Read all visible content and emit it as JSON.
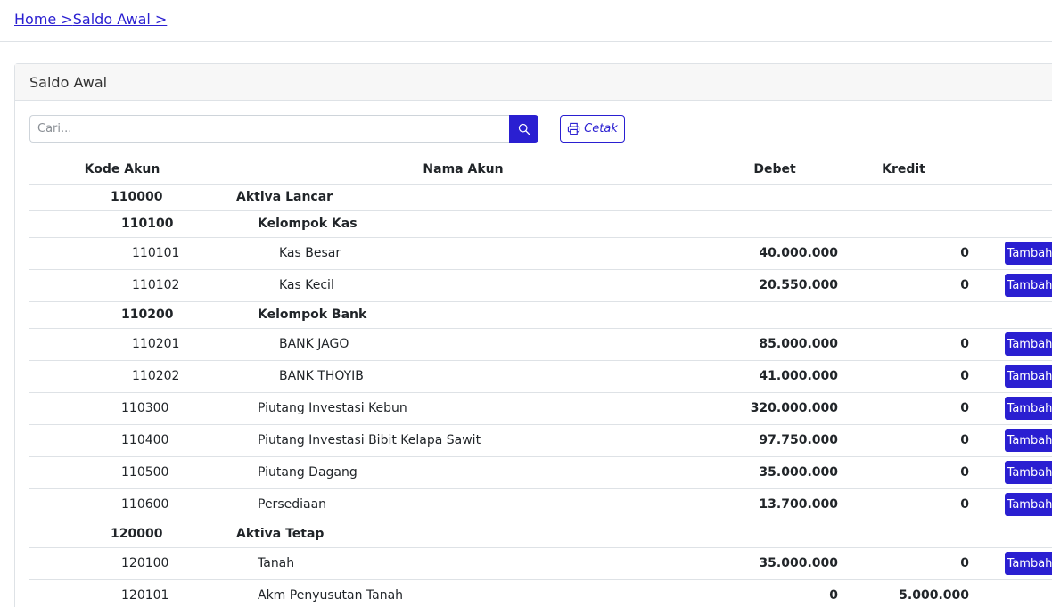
{
  "breadcrumb": {
    "home": "Home >",
    "current": "Saldo Awal >"
  },
  "card": {
    "title": "Saldo Awal"
  },
  "search": {
    "placeholder": "Cari..."
  },
  "print_label": "Cetak",
  "table": {
    "headers": {
      "kode": "Kode Akun",
      "nama": "Nama Akun",
      "debet": "Debet",
      "kredit": "Kredit"
    },
    "add_label": "Tambah",
    "rows": [
      {
        "type": "group",
        "level": 0,
        "kode": "110000",
        "nama": "Aktiva Lancar"
      },
      {
        "type": "group",
        "level": 1,
        "kode": "110100",
        "nama": "Kelompok Kas"
      },
      {
        "type": "item",
        "level": 2,
        "kode": "110101",
        "nama": "Kas Besar",
        "debet": "40.000.000",
        "kredit": "0",
        "button": true
      },
      {
        "type": "item",
        "level": 2,
        "kode": "110102",
        "nama": "Kas Kecil",
        "debet": "20.550.000",
        "kredit": "0",
        "button": true
      },
      {
        "type": "group",
        "level": 1,
        "kode": "110200",
        "nama": "Kelompok Bank"
      },
      {
        "type": "item",
        "level": 2,
        "kode": "110201",
        "nama": "BANK JAGO",
        "debet": "85.000.000",
        "kredit": "0",
        "button": true
      },
      {
        "type": "item",
        "level": 2,
        "kode": "110202",
        "nama": "BANK THOYIB",
        "debet": "41.000.000",
        "kredit": "0",
        "button": true
      },
      {
        "type": "item",
        "level": 1,
        "kode": "110300",
        "nama": "Piutang Investasi Kebun",
        "debet": "320.000.000",
        "kredit": "0",
        "button": true
      },
      {
        "type": "item",
        "level": 1,
        "kode": "110400",
        "nama": "Piutang Investasi Bibit Kelapa Sawit",
        "debet": "97.750.000",
        "kredit": "0",
        "button": true
      },
      {
        "type": "item",
        "level": 1,
        "kode": "110500",
        "nama": "Piutang Dagang",
        "debet": "35.000.000",
        "kredit": "0",
        "button": true
      },
      {
        "type": "item",
        "level": 1,
        "kode": "110600",
        "nama": "Persediaan",
        "debet": "13.700.000",
        "kredit": "0",
        "button": true
      },
      {
        "type": "group",
        "level": 0,
        "kode": "120000",
        "nama": "Aktiva Tetap"
      },
      {
        "type": "item",
        "level": 1,
        "kode": "120100",
        "nama": "Tanah",
        "debet": "35.000.000",
        "kredit": "0",
        "button": true
      },
      {
        "type": "item",
        "level": 1,
        "kode": "120101",
        "nama": "Akm Penyusutan Tanah",
        "debet": "0",
        "kredit": "5.000.000",
        "button": false
      }
    ]
  }
}
